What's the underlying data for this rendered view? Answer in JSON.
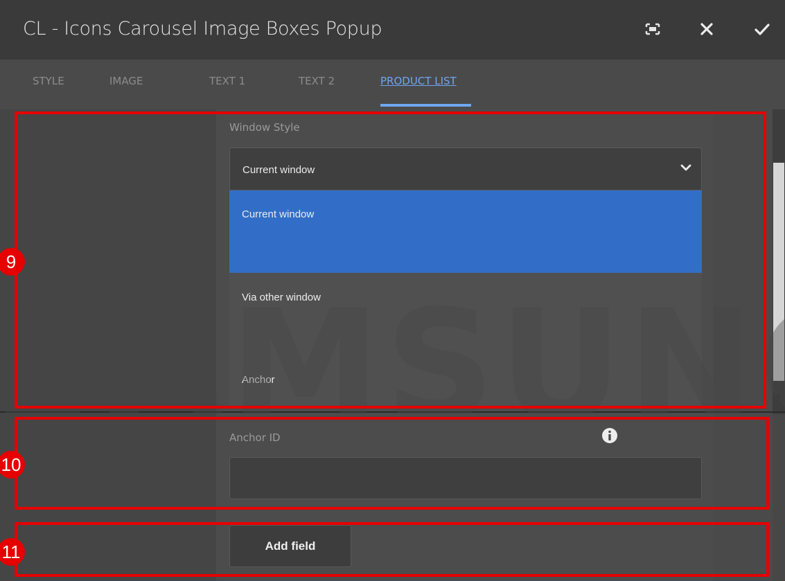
{
  "dialog": {
    "title": "CL - Icons Carousel Image Boxes Popup",
    "buttons": {
      "fullscreen": "fullscreen-icon",
      "close": "close-icon",
      "confirm": "check-icon"
    }
  },
  "tabs": [
    {
      "label": "STYLE",
      "active": false
    },
    {
      "label": "IMAGE",
      "active": false
    },
    {
      "label": "TEXT 1",
      "active": false
    },
    {
      "label": "TEXT 2",
      "active": false
    },
    {
      "label": "PRODUCT LIST",
      "active": true
    }
  ],
  "form": {
    "window_style": {
      "label": "Window Style",
      "selected": "Current window",
      "options": [
        "Current window",
        "Via other window",
        "Anchor"
      ]
    },
    "anchor_id": {
      "label": "Anchor ID",
      "value": ""
    },
    "add_field_label": "Add field"
  },
  "watermark": "SAMSUNG",
  "annotations": [
    "9",
    "10",
    "11"
  ],
  "colors": {
    "accent": "#6ea6f2",
    "selected_option": "#326ec8",
    "annotation": "#e60000"
  }
}
